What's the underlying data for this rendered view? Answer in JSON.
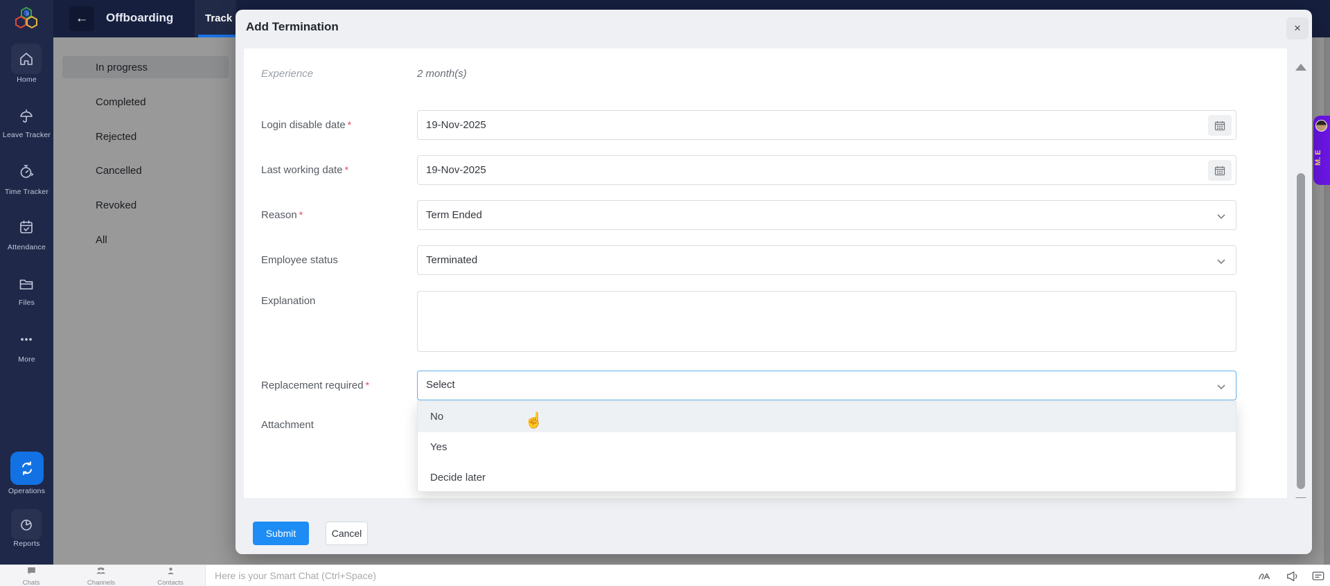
{
  "topbar": {
    "back_label": "←",
    "title": "Offboarding",
    "tab": "Track"
  },
  "sidebar": {
    "items": [
      {
        "label": "Home"
      },
      {
        "label": "Leave Tracker"
      },
      {
        "label": "Time Tracker"
      },
      {
        "label": "Attendance"
      },
      {
        "label": "Files"
      },
      {
        "label": "More"
      },
      {
        "label": "Operations"
      },
      {
        "label": "Reports"
      }
    ]
  },
  "filter_panel": {
    "items": [
      "In progress",
      "Completed",
      "Rejected",
      "Cancelled",
      "Revoked",
      "All"
    ],
    "selected": "In progress"
  },
  "modal": {
    "title": "Add Termination",
    "close_label": "×",
    "required_marker": "*",
    "rows": {
      "experience": {
        "label": "Experience",
        "value": "2 month(s)"
      },
      "login_disable_date": {
        "label": "Login disable date",
        "value": "19-Nov-2025"
      },
      "last_working_date": {
        "label": "Last working date",
        "value": "19-Nov-2025"
      },
      "reason": {
        "label": "Reason",
        "value": "Term Ended"
      },
      "employee_status": {
        "label": "Employee status",
        "value": "Terminated"
      },
      "explanation": {
        "label": "Explanation",
        "value": ""
      },
      "replacement_required": {
        "label": "Replacement required",
        "value": "Select"
      },
      "attachment": {
        "label": "Attachment"
      }
    },
    "dropdown": {
      "options": [
        "No",
        "Yes",
        "Decide later"
      ],
      "highlighted": "No"
    },
    "footer": {
      "submit_label": "Submit",
      "cancel_label": "Cancel"
    }
  },
  "bottom_bar": {
    "items": [
      {
        "label": "Chats"
      },
      {
        "label": "Channels"
      },
      {
        "label": "Contacts"
      }
    ],
    "smart_chat_placeholder": "Here is your Smart Chat (Ctrl+Space)"
  },
  "side_tab": {
    "text": "M. E"
  },
  "colors": {
    "accent_blue": "#1d8cf5",
    "topbar_navy": "#161f3e",
    "sidebar_navy": "#1f2848",
    "purple_tab": "#6d16e9",
    "focus_border": "#5fb0f2",
    "required_red": "#e4485a",
    "tab_underline": "#1a73e8"
  }
}
